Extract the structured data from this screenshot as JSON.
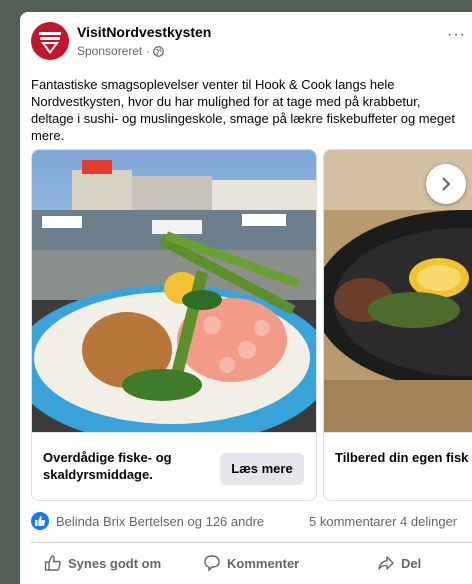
{
  "post": {
    "page_name": "VisitNordvestkysten",
    "sponsored_label": "Sponsoreret · ",
    "more_label": "···",
    "text": "Fantastiske smagsoplevelser venter til Hook & Cook langs hele Nordvestkysten, hvor du har mulighed for at tage med på krabbetur, deltage i sushi- og muslingeskole, smage på lækre fiskebuffeter og meget mere."
  },
  "carousel": {
    "cards": [
      {
        "title": "Overdådige fiske- og skaldyrsmiddage.",
        "cta": "Læs mere"
      },
      {
        "title": "Tilbered din egen fisk over bål."
      }
    ]
  },
  "engagement": {
    "reactions_text": "Belinda Brix Bertelsen og 126 andre",
    "comments_shares_text": "5 kommentarer  4 delinger"
  },
  "actions": {
    "like": "Synes godt om",
    "comment": "Kommenter",
    "share": "Del"
  },
  "colors": {
    "brand": "#c0172f",
    "like_blue": "#1877f2",
    "page_background": "#536055"
  }
}
